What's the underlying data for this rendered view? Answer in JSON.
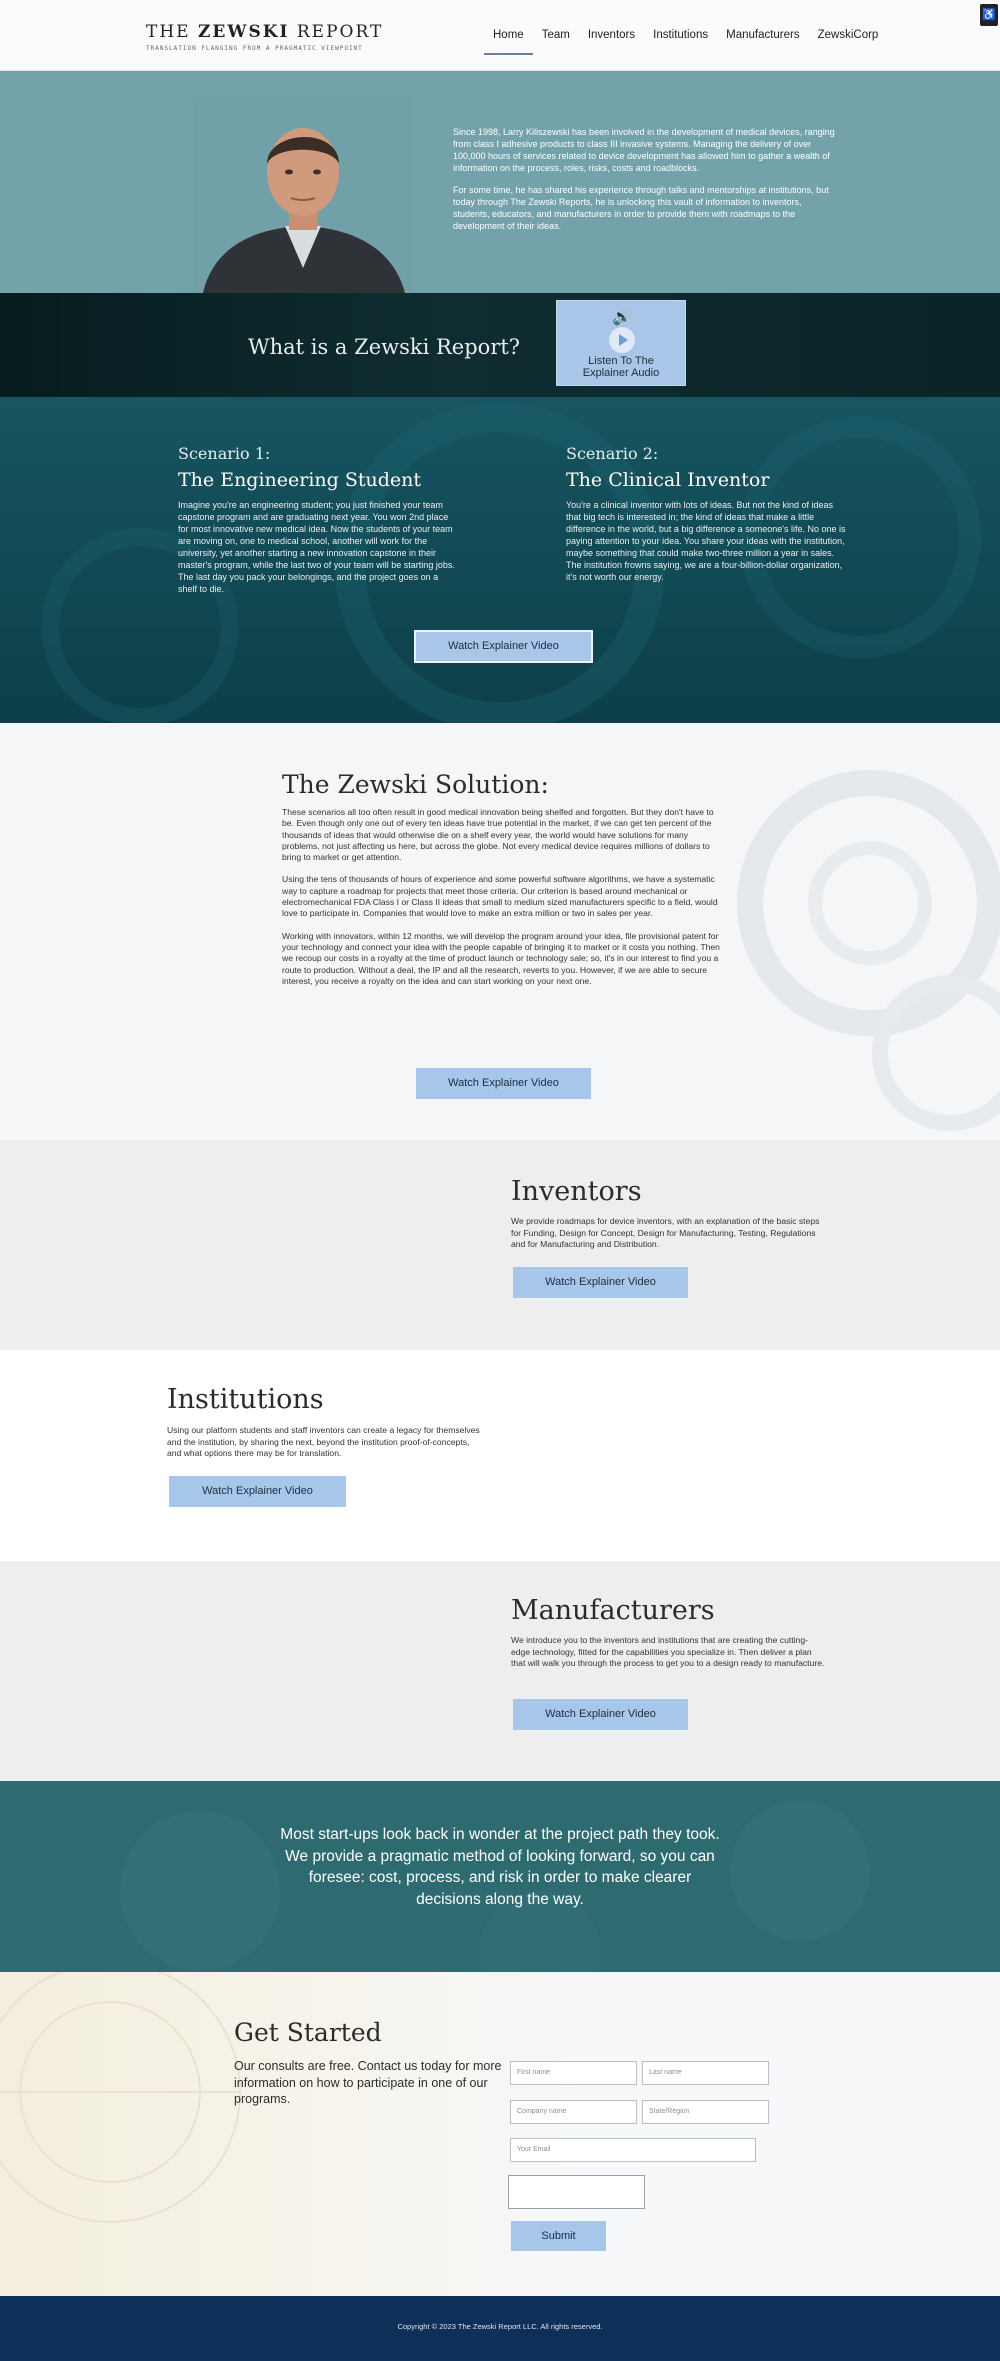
{
  "header": {
    "logo_main_left": "THE ",
    "logo_main_bold": "ZEWSKI",
    "logo_main_right": " REPORT",
    "logo_tagline": "TRANSLATION FLANGING FROM A PRAGMATIC VIEWPOINT",
    "nav": [
      "Home",
      "Team",
      "Inventors",
      "Institutions",
      "Manufacturers",
      "ZewskiCorp"
    ],
    "active_nav": "Home"
  },
  "bio": {
    "paragraph_1": "Since 1998, Larry Kiliszewski has been involved in the development of medical devices, ranging from class I adhesive products to class III invasive systems. Managing the delivery of over 100,000 hours of services related to device development has allowed him to gather a wealth of information on the process, roles, risks, costs and roadblocks.",
    "paragraph_2": "For some time, he has shared his experience through talks and mentorships at institutions, but today through The Zewski Reports, he is unlocking this vault of information to inventors, students, educators, and manufacturers in order to provide them with roadmaps to the development of their ideas."
  },
  "whatis": {
    "title": "What is a Zewski Report?",
    "audio_label_1": "Listen To The",
    "audio_label_2": "Explainer Audio"
  },
  "scenarios": {
    "left": {
      "kicker": "Scenario 1:",
      "title": "The Engineering Student",
      "body": "Imagine you're an engineering student; you just finished your team capstone program and are graduating next year.  You won 2nd place for most innovative new medical idea.  Now the students of your team are moving on, one to medical school, another will work for the university, yet another starting a new innovation capstone in their master's program, while the last two of your team will be starting jobs.  The last day you pack your belongings, and the project goes on a shelf to die."
    },
    "right": {
      "kicker": "Scenario 2:",
      "title": "The Clinical Inventor",
      "body": "You're a clinical inventor with lots of ideas. But not the kind of ideas that big tech is interested in; the kind of ideas that make a little difference in the world, but a big difference a someone's life. No one is paying attention to your idea. You share your ideas with the institution, maybe something that could make two-three million a year in sales. The institution frowns saying, we are a four-billion-dollar organization, it's not worth our energy."
    },
    "button": "Watch Explainer Video"
  },
  "solution": {
    "title": "The Zewski Solution:",
    "paragraphs": [
      "These scenarios all too often result in good medical innovation being shelfed and forgotten. But they don't have to be. Even though only one out of every ten ideas have true potential in the market, if we can get ten percent of the thousands of ideas that would otherwise die on a shelf every year, the world would have solutions for many problems, not just affecting us here, but across the globe. Not every medical device requires millions of dollars to bring to market or get attention.",
      "Using the tens of thousands of hours of experience and some powerful software algorithms, we have a systematic way to capture a roadmap for projects that meet those criteria. Our criterion is based around mechanical or electromechanical FDA Class I or Class II ideas that small to medium sized manufacturers specific to a field, would love to participate in. Companies that would love to make an extra million or two in sales per year.",
      "Working with innovators, within 12 months, we will develop the program around your idea, file provisional patent for your technology and connect your idea with the people capable of bringing it to market or it costs you nothing. Then we recoup our costs in a royalty at the time of product launch or technology sale; so, it's in our interest to find you a route to production. Without a deal, the IP and all the research, reverts to you. However, if we are able to secure interest, you receive a royalty on the idea and can start working on your next one."
    ],
    "button": "Watch Explainer Video"
  },
  "inventors": {
    "title": "Inventors",
    "body": "We provide roadmaps for device inventors, with an explanation of the basic steps for Funding, Design for Concept, Design for Manufacturing, Testing, Regulations and for Manufacturing and Distribution.",
    "button": "Watch Explainer Video"
  },
  "institutions": {
    "title": "Institutions",
    "body": "Using our platform students and staff inventors can create a legacy for themselves and the institution, by sharing the next, beyond the institution proof-of-concepts, and what options there may be for translation.",
    "button": "Watch Explainer Video"
  },
  "manufacturers": {
    "title": "Manufacturers",
    "body": "We introduce you to the inventors and institutions that are creating the cutting-edge technology, fitted for the capabilities you specialize in. Then deliver a plan that will walk you through the process to get you to a design ready to manufacture.",
    "button": "Watch Explainer Video"
  },
  "quote": {
    "text": "Most start-ups look back in wonder at the project path they took.  We provide a pragmatic method of looking forward, so you can foresee: cost, process, and risk in order to make clearer decisions along the way."
  },
  "get_started": {
    "title": "Get Started",
    "body": "Our consults are free. Contact us today for more information on how to participate in one of our programs.",
    "placeholders": {
      "first_name": "First name",
      "last_name": "Last name",
      "company": "Company name",
      "state": "State/Region",
      "email": "Your Email",
      "message": ""
    },
    "submit": "Submit"
  },
  "footer": {
    "copyright": "Copyright © 2023 The Zewski Report LLC.  All rights reserved."
  },
  "colors": {
    "bio_bg": "#74a2ab",
    "scenario_bg": "#114a55",
    "button_blue": "#a6c6ea",
    "quote_bg": "#2e6b71",
    "footer_bg": "#0e2f57"
  },
  "icons": [
    "speaker-icon",
    "play-icon",
    "accessibility-icon"
  ]
}
